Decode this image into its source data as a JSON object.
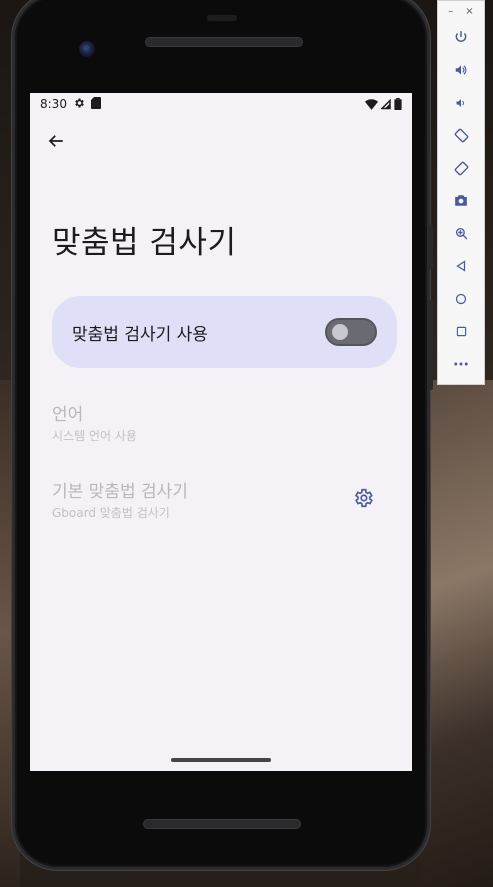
{
  "status_bar": {
    "time": "8:30"
  },
  "page": {
    "title": "맞춤법 검사기"
  },
  "toggle": {
    "label": "맞춤법 검사기 사용",
    "checked": false
  },
  "preferences": [
    {
      "title": "언어",
      "summary": "시스템 언어 사용"
    },
    {
      "title": "기본 맞춤법 검사기",
      "summary": "Gboard 맞춤법 검사기"
    }
  ],
  "toolbar": {
    "minimize_label": "–",
    "close_label": "×",
    "items": [
      "power-icon",
      "volume-up-icon",
      "volume-down-icon",
      "rotate-left-icon",
      "rotate-right-icon",
      "camera-icon",
      "zoom-icon",
      "back-icon",
      "home-icon",
      "overview-icon",
      "more-icon"
    ]
  },
  "colors": {
    "screen_bg": "#f4f1f7",
    "card_bg": "#dfe0f7",
    "accent": "#4a5a9c",
    "disabled_text": "#b9b7bd"
  }
}
